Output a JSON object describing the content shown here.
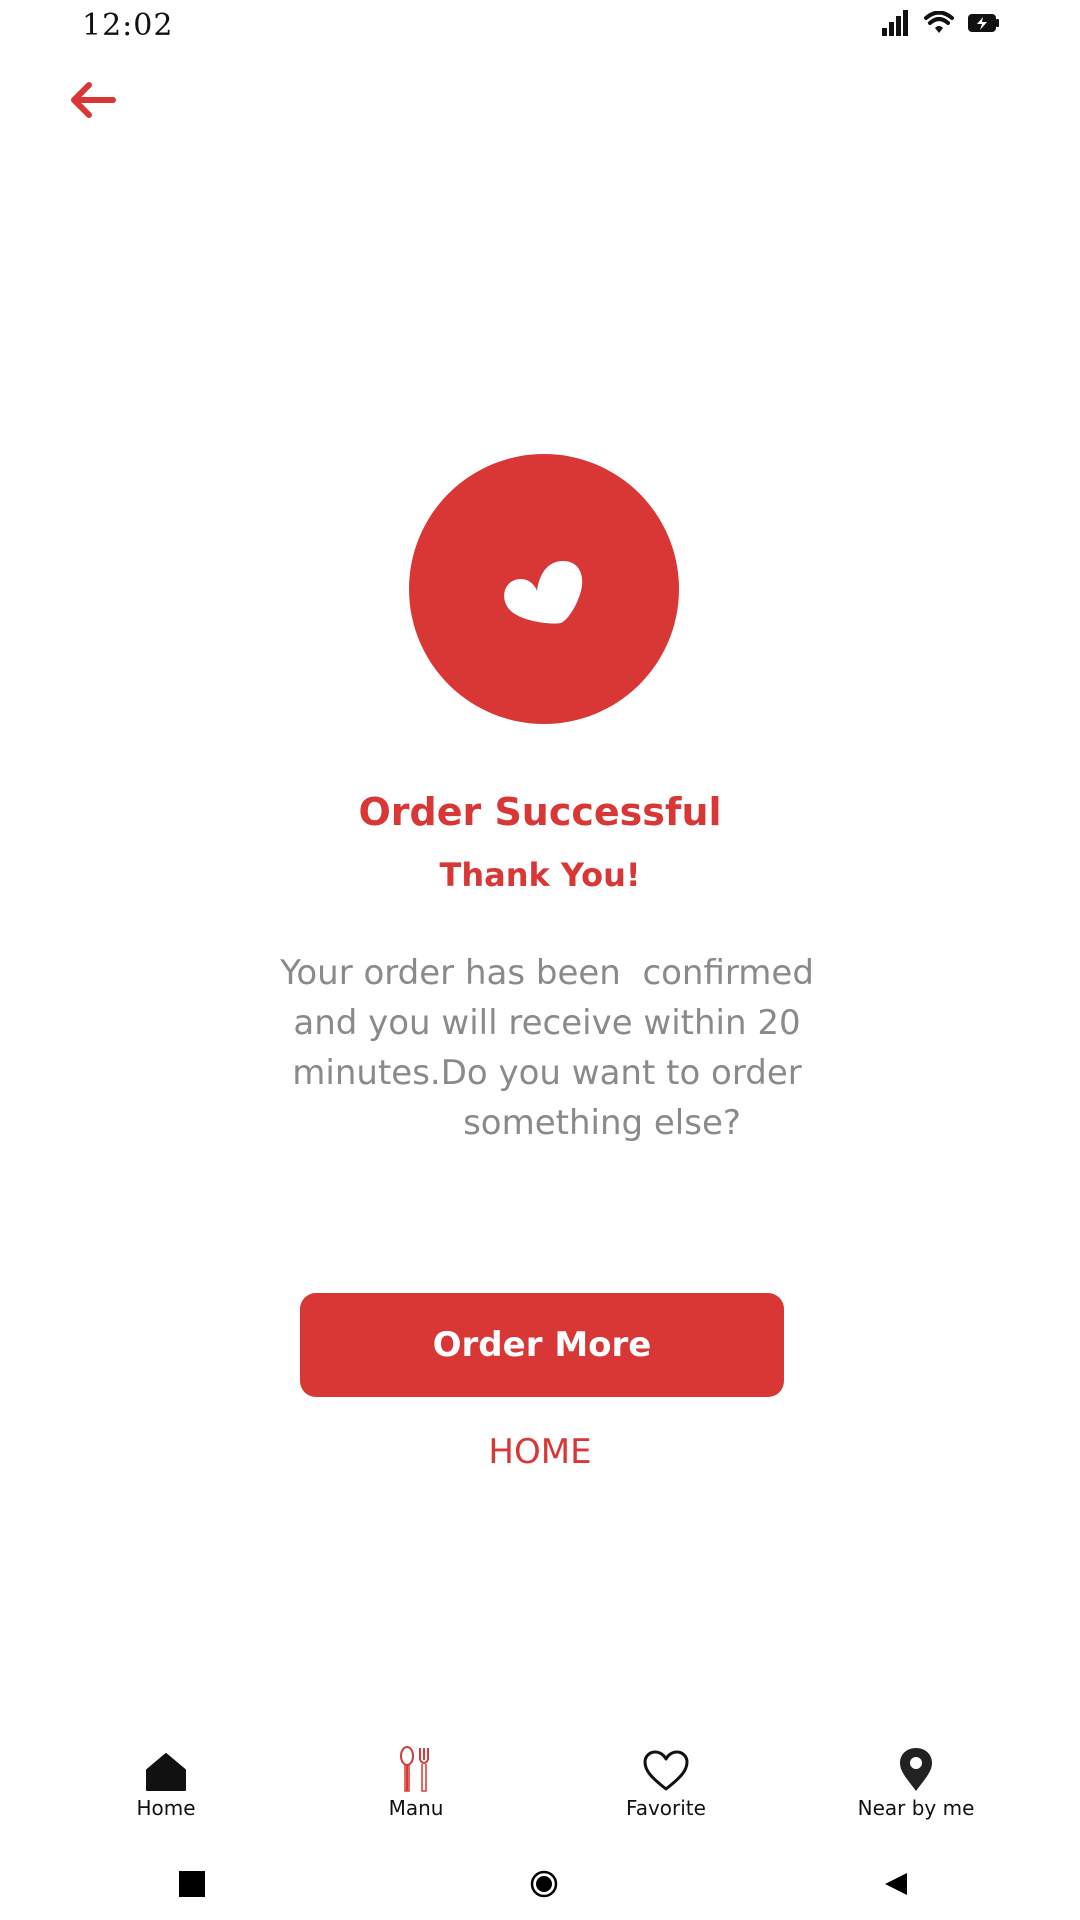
{
  "status_bar": {
    "time": "12:02",
    "icons": [
      "signal-icon",
      "wifi-icon",
      "battery-charging-icon"
    ]
  },
  "header": {
    "back_icon": "arrow-left-icon"
  },
  "hero": {
    "icon": "heart-icon"
  },
  "content": {
    "title": "Order Successful",
    "subtitle": "Thank You!",
    "message_lines": [
      "Your order has been  confirmed",
      "and you will receive within 20",
      "minutes.Do you want to order",
      "something else?"
    ]
  },
  "actions": {
    "order_more_label": "Order More",
    "home_label": "HOME"
  },
  "bottom_nav": {
    "items": [
      {
        "label": "Home",
        "icon": "home-icon"
      },
      {
        "label": "Manu",
        "icon": "fork-spoon-icon"
      },
      {
        "label": "Favorite",
        "icon": "heart-outline-icon"
      },
      {
        "label": "Near by me",
        "icon": "location-pin-icon"
      }
    ]
  },
  "system_nav": {
    "icons": [
      "recent-apps-icon",
      "home-circle-icon",
      "back-triangle-icon"
    ]
  },
  "colors": {
    "accent": "#D93636",
    "message_text": "#8A8A8A",
    "background": "#FFFFFF"
  }
}
